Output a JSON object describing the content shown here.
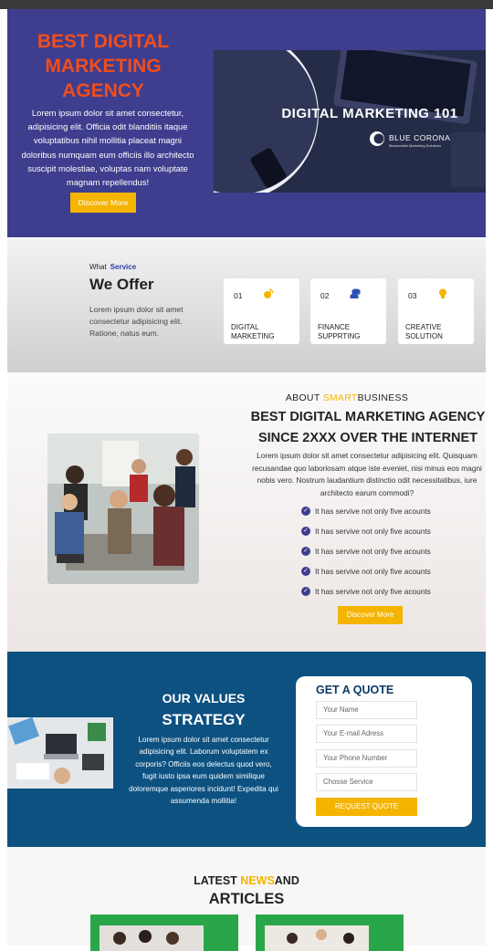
{
  "hero": {
    "title": "BEST DIGITAL MARKETING AGENCY",
    "text": "Lorem ipsum dolor sit amet consectetur, adipisicing elit. Officia odit blanditiis itaque voluptatibus nihil mollitia placeat magni doloribus numquam eum officiis illo architecto suscipit molestiae, voluptas nam voluptate magnam repellendus!",
    "button_label": "Discover More",
    "image_title": "DIGITAL MARKETING 101",
    "image_logo_text": "BLUE CORONA",
    "image_logo_sub": "Measurable Marketing Solutions"
  },
  "services": {
    "kicker": "What",
    "kicker_highlight": "Service",
    "heading": "We Offer",
    "description": "Lorem ipsum dolor sit amet consectetur adipisicing elit. Ratione, natus eum.",
    "cards": [
      {
        "number": "01",
        "label": "DIGITAL MARKETING",
        "icon": "satellite-icon",
        "icon_color": "#f5b400"
      },
      {
        "number": "02",
        "label": "FINANCE SUPPRTING",
        "icon": "coins-icon",
        "icon_color": "#2b4fb5"
      },
      {
        "number": "03",
        "label": "CREATIVE SOLUTION",
        "icon": "lightbulb-icon",
        "icon_color": "#f5b400"
      }
    ]
  },
  "about": {
    "kicker_prefix": "ABOUT",
    "kicker_highlight": "SMART",
    "kicker_suffix": "BUSINESS",
    "title": "BEST DIGITAL MARKETING AGENCY SINCE 2XXX OVER THE INTERNET",
    "text": "Lorem ipsum dolor sit amet consectetur adipisicing elit. Quisquam recusandae quo laboriosam atque iste eveniet, nisi minus eos magni nobis vero. Nostrum laudantium distinctio odit necessitatibus, iure architecto earum commodi?",
    "checklist": [
      "It has servive not only five acounts",
      "It has servive not only five acounts",
      "It has servive not only five acounts",
      "It has servive not only five acounts",
      "It has servive not only five acounts"
    ],
    "button_label": "Discover More"
  },
  "values": {
    "title_line1": "OUR VALUES",
    "title_line2": "STRATEGY",
    "text": "Lorem ipsum dolor sit amet consectetur adipisicing elit. Laborum voluptatem ex corporis? Officiis eos delectus quod vero, fugit iusto ipsa eum quidem similique doloremque asperiores incidunt! Expedita qui assumenda mollitia!"
  },
  "quote": {
    "title": "GET A QUOTE",
    "name_placeholder": "Your Name",
    "email_placeholder": "Your E-mail Adress",
    "phone_placeholder": "Your Phone Number",
    "service_placeholder": "Chosse Service",
    "button_label": "REQUEST QUOTE"
  },
  "news": {
    "title_prefix": "LATEST ",
    "title_highlight": "NEWS",
    "title_suffix": "AND",
    "subtitle": "ARTICLES"
  },
  "colors": {
    "hero_bg": "#3f3d8e",
    "accent_orange": "#f04e1c",
    "accent_yellow": "#f5b400",
    "values_bg": "#0d5180",
    "news_card": "#2aa64a"
  }
}
